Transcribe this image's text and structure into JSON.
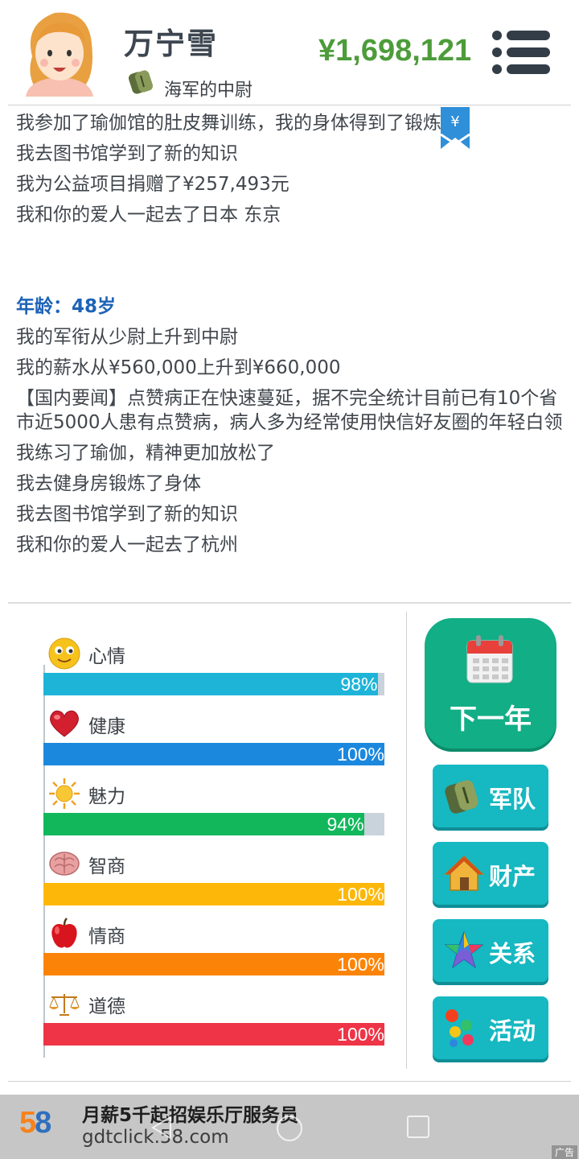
{
  "profile": {
    "name": "万宁雪",
    "rank": "海军的中尉",
    "money": "¥1,698,121"
  },
  "log": {
    "lines_before": [
      "我参加了瑜伽馆的肚皮舞训练，我的身体得到了锻炼",
      "我去图书馆学到了新的知识",
      "我为公益项目捐赠了¥257,493元",
      "我和你的爱人一起去了日本 东京"
    ],
    "age_label": "年龄：48岁",
    "lines_after": [
      "我的军衔从少尉上升到中尉",
      "我的薪水从¥560,000上升到¥660,000",
      "【国内要闻】点赞病正在快速蔓延，据不完全统计目前已有10个省市近5000人患有点赞病，病人多为经常使用快信好友圈的年轻白领",
      "我练习了瑜伽，精神更加放松了",
      "我去健身房锻炼了身体",
      "我去图书馆学到了新的知识",
      "我和你的爱人一起去了杭州"
    ],
    "bookmark_symbol": "¥"
  },
  "stats": [
    {
      "label": "心情",
      "percent": 98,
      "percent_text": "98%",
      "color": "#1eb4d8",
      "icon": "smiley-icon"
    },
    {
      "label": "健康",
      "percent": 100,
      "percent_text": "100%",
      "color": "#1b88de",
      "icon": "heart-icon"
    },
    {
      "label": "魅力",
      "percent": 94,
      "percent_text": "94%",
      "color": "#12b75c",
      "icon": "sun-icon"
    },
    {
      "label": "智商",
      "percent": 100,
      "percent_text": "100%",
      "color": "#fdb709",
      "icon": "brain-icon"
    },
    {
      "label": "情商",
      "percent": 100,
      "percent_text": "100%",
      "color": "#fb8408",
      "icon": "apple-icon"
    },
    {
      "label": "道德",
      "percent": 100,
      "percent_text": "100%",
      "color": "#ee3446",
      "icon": "scales-icon"
    }
  ],
  "actions": {
    "next_year": "下一年",
    "army": "军队",
    "property": "财产",
    "relations": "关系",
    "activities": "活动"
  },
  "ad": {
    "logo": "58",
    "title": "月薪5千起招娱乐厅服务员",
    "url": "gdtclick.58.com",
    "tag": "广告"
  }
}
